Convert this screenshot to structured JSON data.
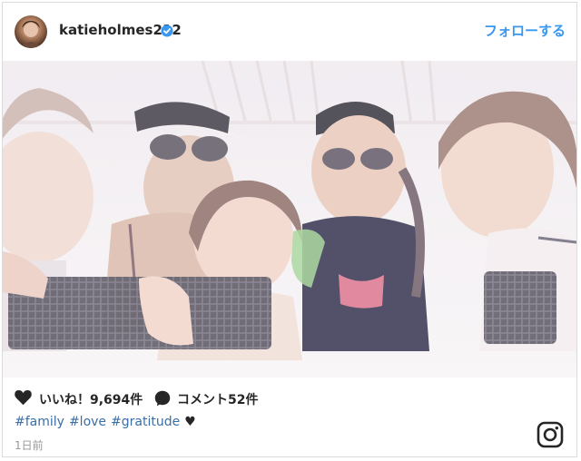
{
  "post": {
    "username": "katieholmes212",
    "follow_label": "フォローする",
    "likes": "いいね！9,694件",
    "comments": "コメント52件",
    "caption_tags": [
      "#family",
      "#love",
      "#gratitude"
    ],
    "caption_emoji": "♥",
    "time_ago": "1日前"
  },
  "colors": {
    "accent": "#3897f0",
    "hashtag": "#3a6ea5",
    "border": "#dbdbdb"
  },
  "icons": {
    "verified": "verified-badge-icon",
    "like": "heart-icon",
    "comment": "comment-bubble-icon",
    "brand": "instagram-logo-icon"
  }
}
